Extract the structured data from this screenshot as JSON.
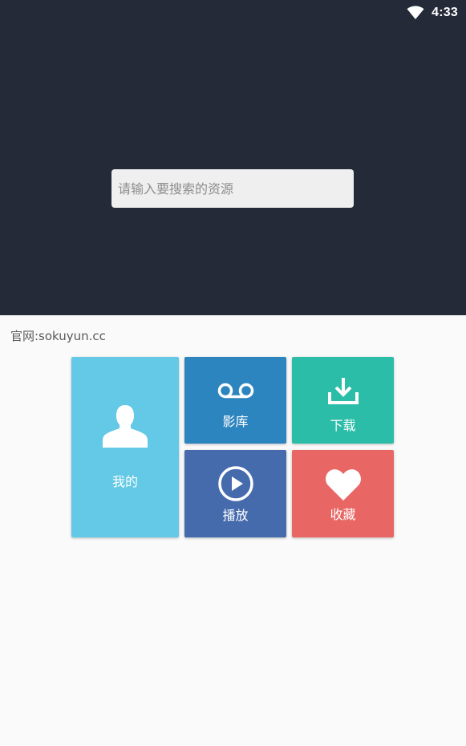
{
  "status_bar": {
    "time": "4:33",
    "wifi_icon": "wifi-icon"
  },
  "search": {
    "placeholder": "请输入要搜索的资源",
    "value": ""
  },
  "site": {
    "label": "官网:sokuyun.cc"
  },
  "tiles": {
    "mine": {
      "label": "我的",
      "icon": "user-icon",
      "color": "#63c9e6"
    },
    "library": {
      "label": "影库",
      "icon": "voicemail-icon",
      "color": "#2d85bf"
    },
    "download": {
      "label": "下载",
      "icon": "download-icon",
      "color": "#2cbda9"
    },
    "play": {
      "label": "播放",
      "icon": "play-circle-icon",
      "color": "#456bad"
    },
    "favorites": {
      "label": "收藏",
      "icon": "heart-icon",
      "color": "#e86764"
    }
  },
  "colors": {
    "header_bg": "#242a38",
    "body_bg": "#fafafa",
    "search_bg": "#efefef"
  }
}
